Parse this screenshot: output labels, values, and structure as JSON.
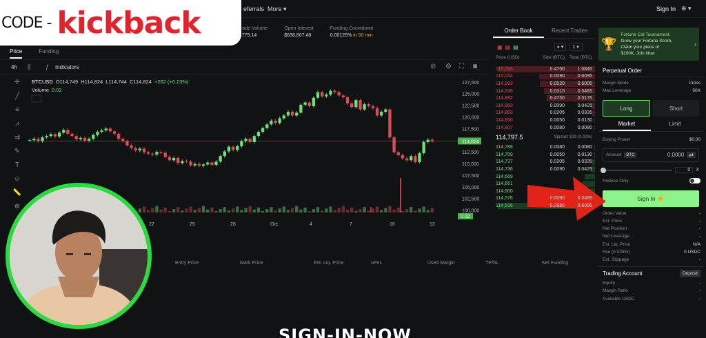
{
  "brand": {
    "code": "CODE -",
    "name": "kickback"
  },
  "nav": {
    "referrals": "eferrals",
    "more": "More ▾",
    "sign_in": "Sign In",
    "globe": "⊕ ▾"
  },
  "stats": [
    {
      "label": "Trade Volume",
      "value": "3,779.14"
    },
    {
      "label": "Open Interest",
      "value": "$638,807.48"
    },
    {
      "label": "Funding Countdown",
      "value": "0.00125%",
      "extra": "in 50 min"
    }
  ],
  "chart_tabs": {
    "price": "Price",
    "funding": "Funding"
  },
  "toolbar": {
    "interval": "4h",
    "indicators": "Indicators"
  },
  "ohlc": {
    "symbol": "BTCUSD",
    "o": "O114,749",
    "h": "H114,824",
    "l": "L114,744",
    "c": "C114,824",
    "change": "+262 (+0.23%)",
    "volume_label": "Volume",
    "volume_value": "0.02"
  },
  "chart_data": {
    "type": "line",
    "title": "BTCUSD",
    "ylabel": "",
    "xlabel": "",
    "x_ticks": [
      "22",
      "25",
      "28",
      "Oct",
      "4",
      "7",
      "10",
      "13"
    ],
    "y_ticks": [
      "127,500",
      "125,000",
      "122,500",
      "120,000",
      "117,500",
      "115,000",
      "112,500",
      "110,000",
      "107,500",
      "105,000",
      "102,500",
      "100,000"
    ],
    "ylim": [
      99500,
      128500
    ],
    "last_price_label": "114,824",
    "volume_label": "0.02",
    "series": [
      {
        "values": [
          115000,
          115300,
          114800,
          115600,
          115900,
          116300,
          115800,
          116600,
          117200,
          116400,
          115900,
          115200,
          115500,
          114900,
          115300,
          116100,
          116800,
          117100,
          117500,
          116900,
          116400,
          115300,
          114800,
          113900,
          113300,
          112800,
          113200,
          112400,
          112100,
          111900,
          112500,
          112300,
          111400,
          110700,
          111200,
          110100,
          110500,
          110400,
          109600,
          109900,
          109500,
          109800,
          110200,
          109700,
          110400,
          111600,
          112600,
          113600,
          112900,
          113700,
          114800,
          115300,
          114600,
          115900,
          116800,
          117600,
          118400,
          119200,
          118700,
          119700,
          120300,
          121100,
          120300,
          120900,
          122600,
          123100,
          122300,
          124100,
          125300,
          124400,
          124800,
          125600,
          125300,
          124600,
          124200,
          122900,
          122100,
          123600,
          121600,
          122700,
          122300,
          121900,
          120300,
          121100,
          121600,
          115600,
          112400,
          111800,
          111100,
          110700,
          111600,
          110300,
          112200,
          114600,
          115100,
          114800
        ]
      }
    ]
  },
  "positions_header": [
    "Entry Price",
    "Mark Price",
    "Est. Liq. Price",
    "uPnL",
    "Used Margin",
    "TP/SL",
    "Net Funding"
  ],
  "orderbook": {
    "tabs": [
      "Order Book",
      "Recent Trades"
    ],
    "grouping": "1",
    "cols": [
      "Price (USD)",
      "Size (BTC)",
      "Total (BTC)"
    ],
    "asks": [
      {
        "p": "115,093",
        "s": "0.4750",
        "t": "1.0845",
        "depth": 0.95
      },
      {
        "p": "115,034",
        "s": "0.0090",
        "t": "0.6095",
        "depth": 0.55
      },
      {
        "p": "114,993",
        "s": "0.0520",
        "t": "0.6005",
        "depth": 0.54
      },
      {
        "p": "114,936",
        "s": "0.0310",
        "t": "0.5485",
        "depth": 0.5
      },
      {
        "p": "114,892",
        "s": "0.4750",
        "t": "0.5175",
        "depth": 0.47
      },
      {
        "p": "114,863",
        "s": "0.0090",
        "t": "0.0425",
        "depth": 0.04
      },
      {
        "p": "114,863",
        "s": "0.0205",
        "t": "0.0335",
        "depth": 0.03
      },
      {
        "p": "114,850",
        "s": "0.0050",
        "t": "0.0130",
        "depth": 0.01
      },
      {
        "p": "114,807",
        "s": "0.0080",
        "t": "0.0080",
        "depth": 0.01
      }
    ],
    "mid_price": "114,797.5",
    "spread": "Spread: $19 (0.02%)",
    "bids": [
      {
        "p": "114,788",
        "s": "0.0080",
        "t": "0.0080",
        "depth": 0.01
      },
      {
        "p": "114,759",
        "s": "0.0050",
        "t": "0.0130",
        "depth": 0.01
      },
      {
        "p": "114,737",
        "s": "0.0205",
        "t": "0.0335",
        "depth": 0.03
      },
      {
        "p": "114,736",
        "s": "0.0090",
        "t": "0.0425",
        "depth": 0.04
      },
      {
        "p": "114,669",
        "s": "",
        "t": "",
        "depth": 0.1
      },
      {
        "p": "114,651",
        "s": "",
        "t": "",
        "depth": 0.12
      },
      {
        "p": "114,600",
        "s": "",
        "t": "",
        "depth": 0.15
      },
      {
        "p": "114,576",
        "s": "0.0090",
        "t": "0.5485",
        "depth": 0.5
      },
      {
        "p": "114,516",
        "s": "0.2980",
        "t": "0.6095",
        "depth": 0.95
      }
    ]
  },
  "promo": {
    "title": "Fortune Cat Tournament",
    "line2": "Grow your Fortune Score,",
    "line3": "Claim your piece of",
    "line4": "$100K. Join Now"
  },
  "order": {
    "title": "Perpetual Order",
    "margin_mode_label": "Margin Mode",
    "margin_mode_value": "Cross",
    "max_lev_label": "Max Leverage",
    "max_lev_value": "50X",
    "long": "Long",
    "short": "Short",
    "market": "Market",
    "limit": "Limit",
    "buying_power_label": "Buying Power",
    "buying_power_value": "$0.00",
    "amount_label": "Amount",
    "amount_cur": "BTC",
    "amount_value": "0.0000",
    "slider_value": "0",
    "slider_unit": "X",
    "reduce_only": "Reduce Only",
    "sign_in": "Sign In",
    "details": [
      {
        "k": "Order Value",
        "v": "-"
      },
      {
        "k": "Est. Price",
        "v": "-"
      },
      {
        "k": "Net Position",
        "v": "-"
      },
      {
        "k": "Net Leverage",
        "v": "-"
      },
      {
        "k": "Est. Liq. Price",
        "v": "N/A"
      },
      {
        "k": "Fee (0.035%)",
        "v": "0 USDC"
      },
      {
        "k": "Est. Slippage",
        "v": "-"
      }
    ]
  },
  "account": {
    "title": "Trading Account",
    "deposit": "Deposit",
    "rows": [
      {
        "k": "Equity",
        "v": "-"
      },
      {
        "k": "Margin Ratio",
        "v": "-"
      },
      {
        "k": "Available USDC",
        "v": "-"
      }
    ]
  },
  "caption": "SIGN-IN-NOW",
  "colors": {
    "green": "#6ee07a",
    "red": "#e34a57",
    "webcam_ring": "#2bd940",
    "arrow": "#e2231a"
  }
}
